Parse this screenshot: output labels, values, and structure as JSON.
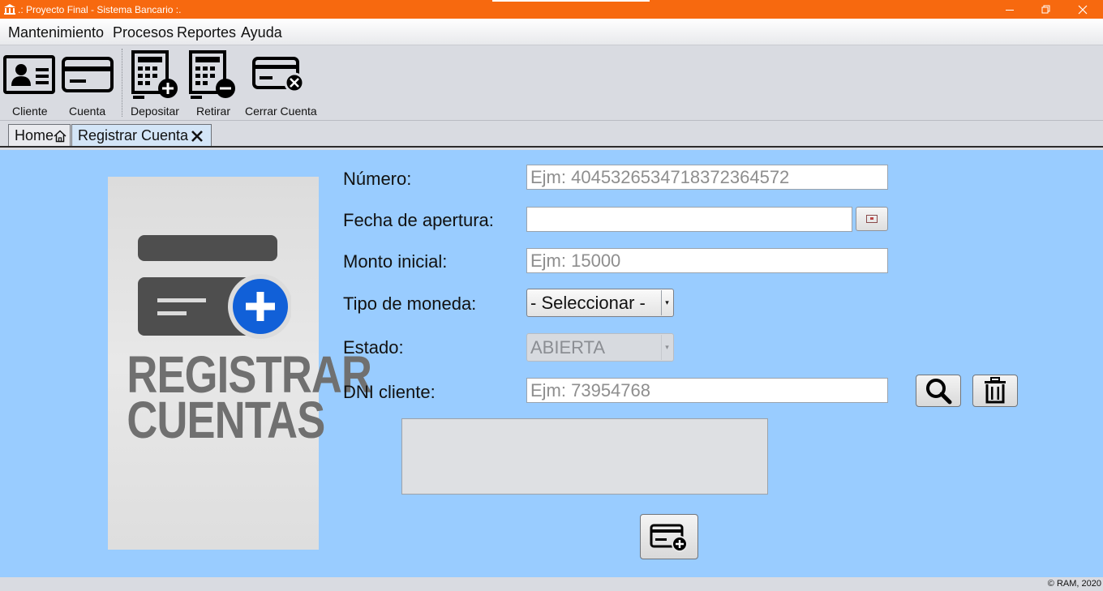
{
  "window": {
    "title": ".: Proyecto Final - Sistema Bancario :.",
    "accent_color": "#f7690f",
    "controls": [
      "minimize-icon",
      "restore-icon",
      "close-icon"
    ]
  },
  "menu": {
    "items": [
      "Mantenimiento",
      "Procesos",
      "Reportes",
      "Ayuda"
    ]
  },
  "toolbar": {
    "buttons": [
      {
        "label": "Cliente",
        "icon": "id-card-icon"
      },
      {
        "label": "Cuenta",
        "icon": "credit-card-icon"
      },
      {
        "label": "Depositar",
        "icon": "deposit-icon"
      },
      {
        "label": "Retirar",
        "icon": "withdraw-icon"
      },
      {
        "label": "Cerrar Cuenta",
        "icon": "close-account-icon"
      }
    ]
  },
  "tabs": [
    {
      "label": "Home",
      "icon": "home-icon",
      "active": false
    },
    {
      "label": "Registrar Cuenta",
      "icon": "close-tab-icon",
      "active": true
    }
  ],
  "banner": {
    "line1": "REGISTRAR",
    "line2": "CUENTAS",
    "icon": "add-card-icon"
  },
  "form": {
    "numero": {
      "label": "Número:",
      "placeholder": "Ejm: 40453265347183723645​72",
      "value": ""
    },
    "fecha": {
      "label": "Fecha de apertura:",
      "value": "",
      "button_icon": "calendar-icon"
    },
    "monto": {
      "label": "Monto inicial:",
      "placeholder": "Ejm: 15000",
      "value": ""
    },
    "moneda": {
      "label": "Tipo de moneda:",
      "selected": "- Seleccionar -"
    },
    "estado": {
      "label": "Estado:",
      "selected": "ABIERTA",
      "enabled": false
    },
    "dni": {
      "label": "DNI cliente:",
      "placeholder": "Ejm: 73954768",
      "value": ""
    },
    "search_icon": "search-icon",
    "delete_icon": "trash-icon",
    "save_icon": "add-card-icon"
  },
  "status": {
    "copyright": "© RAM, 2020"
  }
}
